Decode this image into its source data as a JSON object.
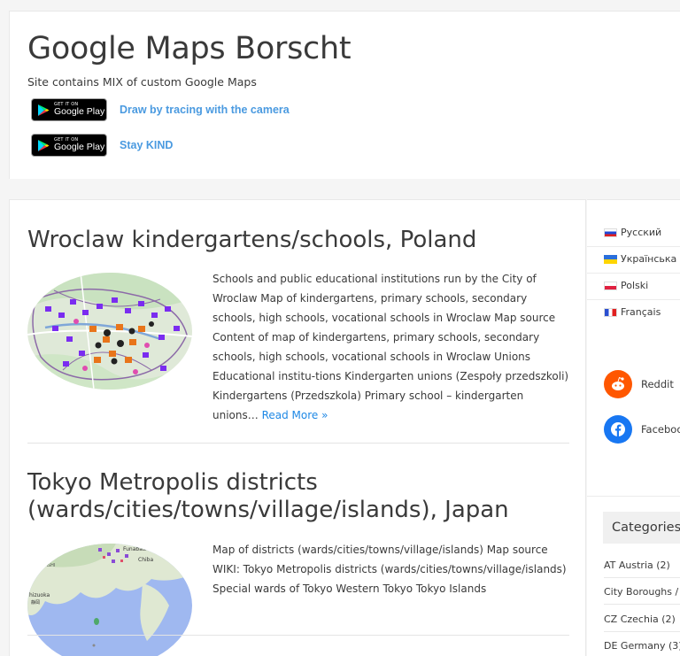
{
  "header": {
    "title": "Google Maps Borscht",
    "description": "Site contains MIX of custom Google Maps",
    "promos": [
      {
        "badge_small": "GET IT ON",
        "badge_big": "Google Play",
        "link": "Draw by tracing with the camera"
      },
      {
        "badge_small": "GET IT ON",
        "badge_big": "Google Play",
        "link": "Stay KIND"
      }
    ]
  },
  "posts": [
    {
      "title": "Wroclaw kindergartens/schools, Poland",
      "excerpt": "Schools and public educational institutions run by the City of Wroclaw Map of kindergartens, primary schools, secondary schools, high schools, vocational schools in Wroclaw Map source Content of map of kindergartens, primary schools, secondary schools, high schools, vocational schools in Wroclaw Unions Educational institu-tions Kindergarten unions (Zespoły przedszkoli) Kindergartens (Przedszkola) Primary school – kindergarten unions…",
      "read_more": "Read More »"
    },
    {
      "title": "Tokyo Metropolis districts (wards/cities/towns/village/islands), Japan",
      "excerpt": "Map of districts (wards/cities/towns/village/islands) Map source WIKI: Tokyo Metropolis districts (wards/cities/towns/village/islands) Special wards of Tokyo Western Tokyo Tokyo Islands",
      "map_labels": [
        "Funabashi",
        "Chiba",
        "MANASHI",
        "hizuoka",
        "静岡"
      ]
    }
  ],
  "sidebar": {
    "languages": [
      {
        "label": "Русский",
        "flag": "flag-ru"
      },
      {
        "label": "Українська",
        "flag": "flag-ua"
      },
      {
        "label": "Polski",
        "flag": "flag-pl"
      },
      {
        "label": "Français",
        "flag": "flag-fr"
      }
    ],
    "share": [
      {
        "label": "Reddit",
        "icon": "reddit-icon",
        "color": "#ff5700"
      },
      {
        "label": "Faceboo",
        "icon": "facebook-icon",
        "color": "#1877f2"
      }
    ],
    "categories_title": "Categories",
    "categories": [
      {
        "label": "AT Austria",
        "count": "(2)"
      },
      {
        "label": "City Boroughs /",
        "count": ""
      },
      {
        "label": "CZ Czechia",
        "count": "(2)"
      },
      {
        "label": "DE Germany",
        "count": "(3)"
      }
    ]
  },
  "colors": {
    "link_blue": "#4a9ae0",
    "read_more": "#1e88e5",
    "text": "#3a3a3a",
    "reddit": "#ff5700",
    "facebook": "#1877f2"
  }
}
